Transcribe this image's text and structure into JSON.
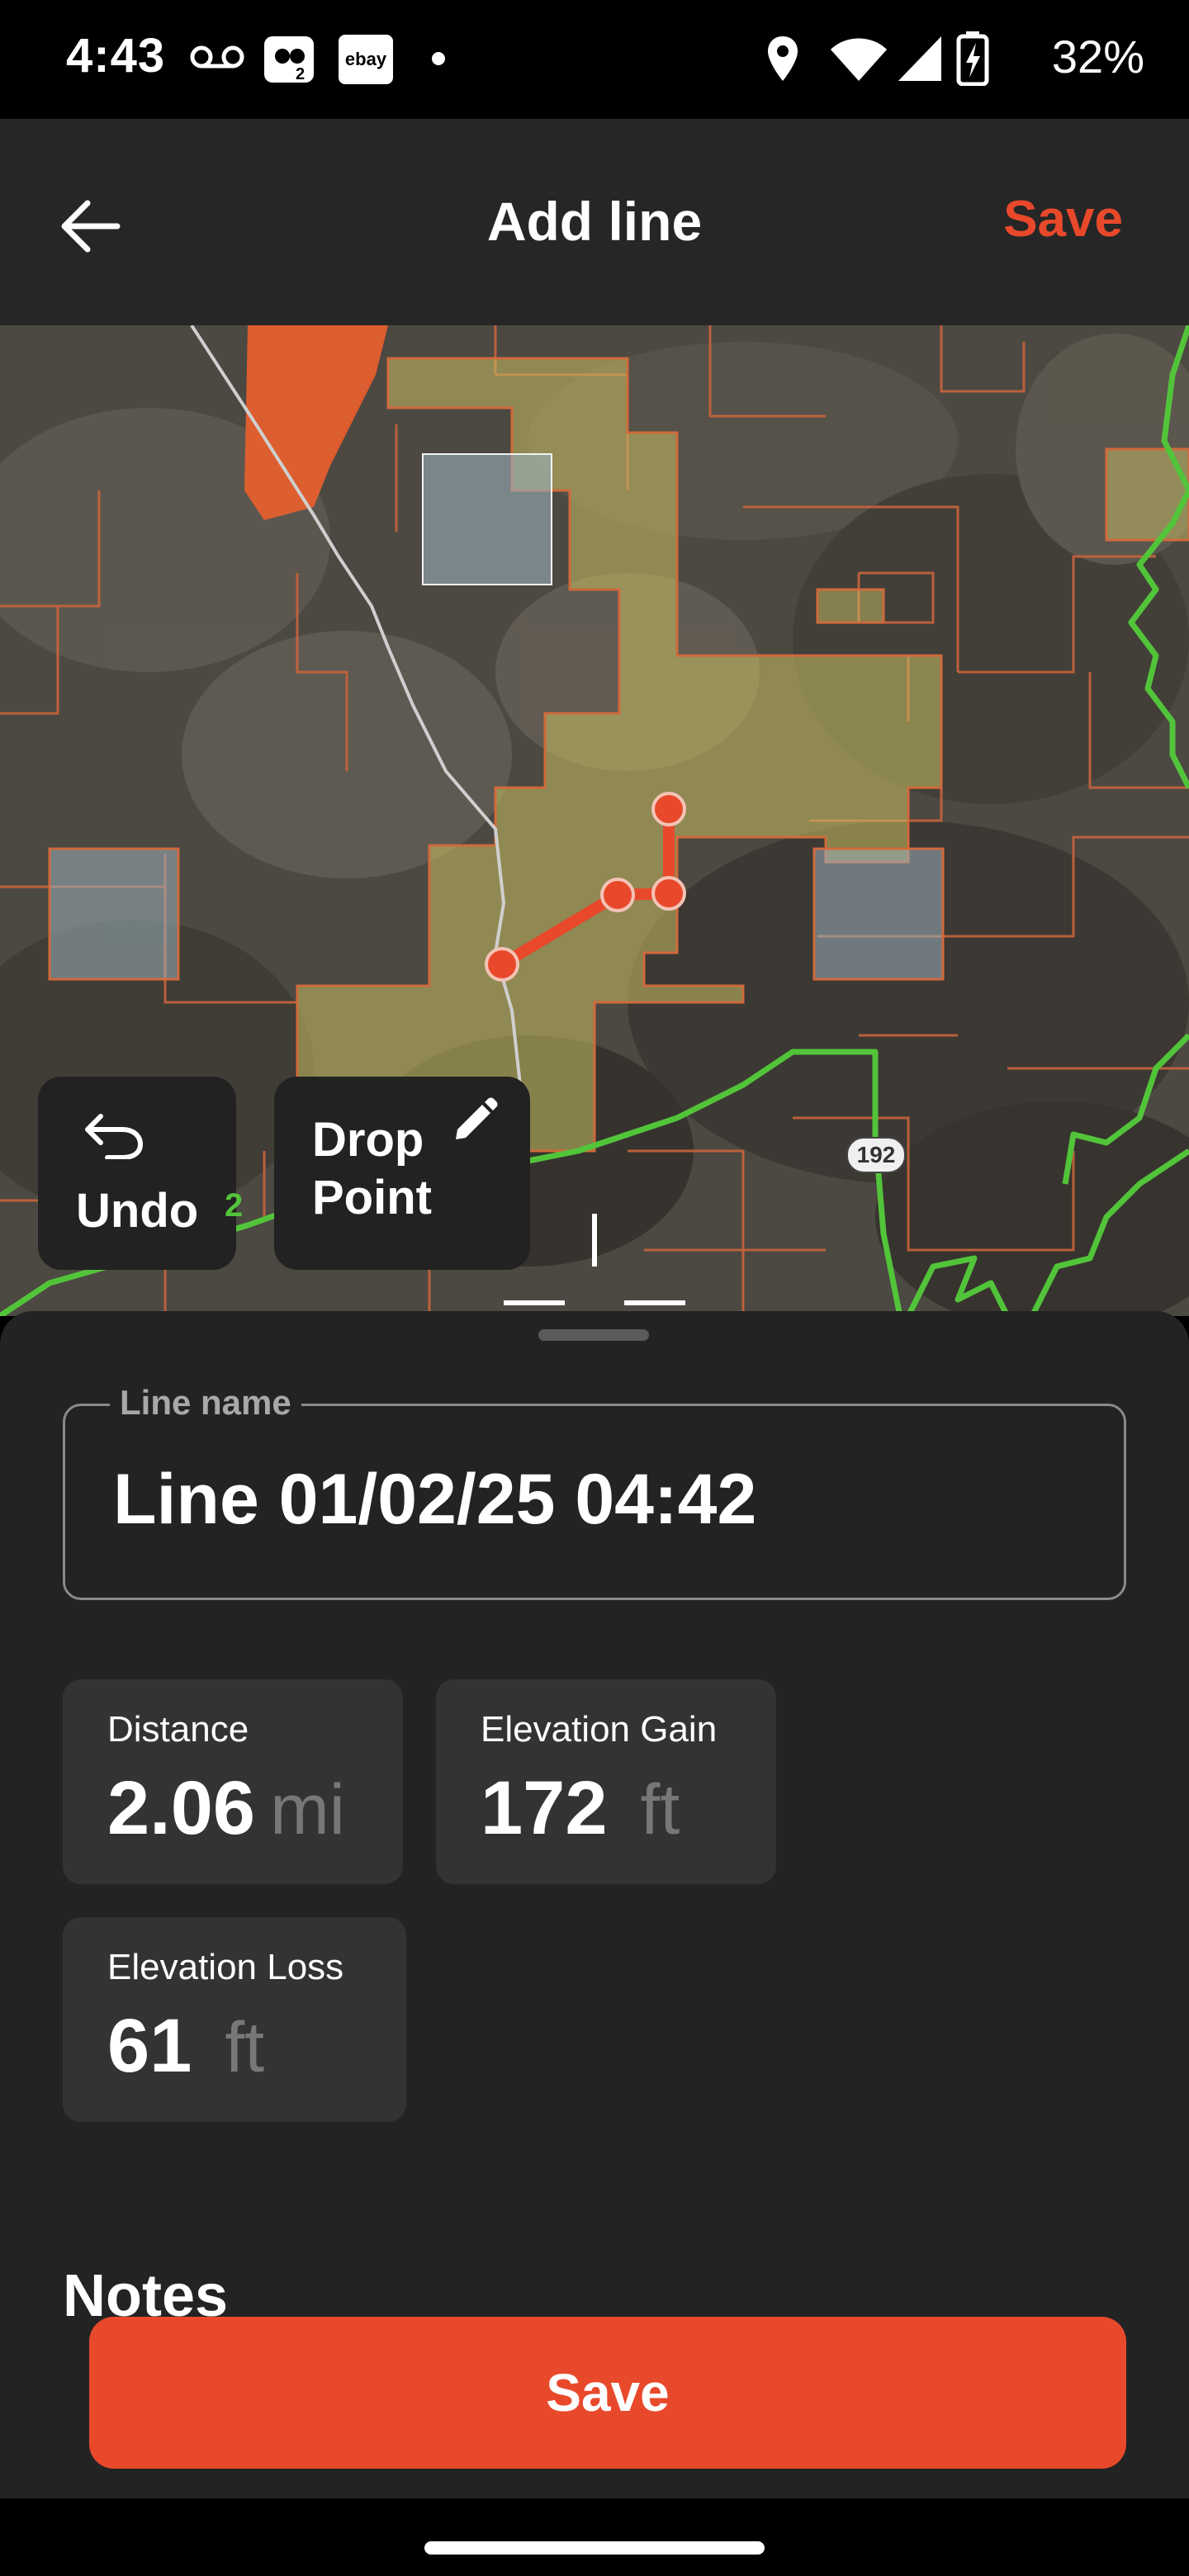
{
  "status_bar": {
    "time": "4:43",
    "icons": [
      "voicemail-icon",
      "app-notification-icon",
      "ebay-icon",
      "dot-icon",
      "location-icon",
      "wifi-icon",
      "signal-icon",
      "battery-charging-icon"
    ],
    "ebay_text": "ebay",
    "battery": "32%"
  },
  "app_bar": {
    "title": "Add line",
    "save_label": "Save",
    "accent": "#e8492b"
  },
  "map": {
    "road_marker": "192",
    "route_label_fragment": "2",
    "undo_label": "Undo",
    "drop_point_label": "Drop Point",
    "line_color": "#e8492b",
    "public_land_color": "#c8c06a",
    "boundary_green": "#52c43a"
  },
  "form": {
    "line_name_label": "Line name",
    "line_name_value": "Line 01/02/25 04:42"
  },
  "stats": {
    "distance": {
      "label": "Distance",
      "value": "2.06",
      "unit": "mi"
    },
    "elevation_gain": {
      "label": "Elevation Gain",
      "value": "172",
      "unit": "ft"
    },
    "elevation_loss": {
      "label": "Elevation Loss",
      "value": "61",
      "unit": "ft"
    }
  },
  "notes_heading": "Notes",
  "save_button_label": "Save"
}
